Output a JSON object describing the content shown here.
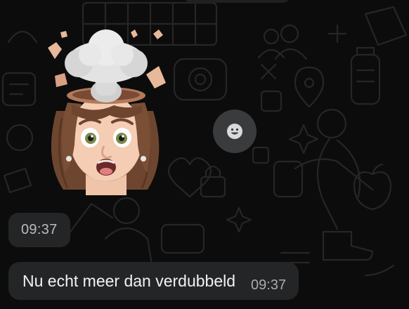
{
  "chat": {
    "background_color": "#0c0c0c",
    "doodle_color": "#2a2a2a",
    "sticker": {
      "icon": "mind-blown-memoji-sticker"
    },
    "react_button": {
      "icon": "smiley-face-icon"
    },
    "sticker_time": "09:37",
    "message": {
      "text": "Nu echt meer dan verdubbeld",
      "time": "09:37",
      "bubble_color": "#242526"
    }
  }
}
